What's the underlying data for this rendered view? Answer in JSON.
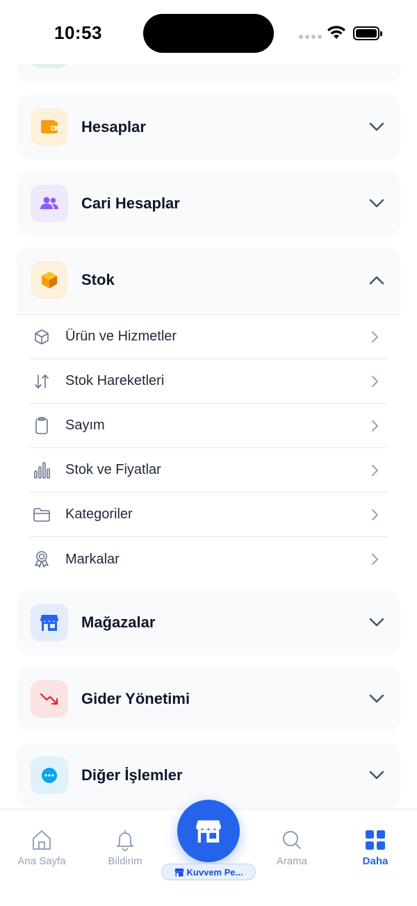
{
  "status_bar": {
    "time": "10:53"
  },
  "colors": {
    "accent": "#2563eb",
    "wallet": "#f59e0b",
    "people": "#8b5cf6",
    "box": "#f59e0b",
    "store": "#2563eb",
    "expense": "#dc2626",
    "more": "#0ea5e9"
  },
  "sections": [
    {
      "title": "Hesaplar",
      "icon": "wallet-icon",
      "expanded": false
    },
    {
      "title": "Cari Hesaplar",
      "icon": "people-icon",
      "expanded": false
    },
    {
      "title": "Stok",
      "icon": "box-icon",
      "expanded": true
    },
    {
      "title": "Mağazalar",
      "icon": "store-icon",
      "expanded": false
    },
    {
      "title": "Gider Yönetimi",
      "icon": "trend-down-icon",
      "expanded": false
    },
    {
      "title": "Diğer İşlemler",
      "icon": "more-icon",
      "expanded": false
    }
  ],
  "stok_items": [
    {
      "label": "Ürün ve Hizmetler",
      "icon": "cube-outline-icon"
    },
    {
      "label": "Stok Hareketleri",
      "icon": "arrows-up-down-icon"
    },
    {
      "label": "Sayım",
      "icon": "clipboard-icon"
    },
    {
      "label": "Stok ve Fiyatlar",
      "icon": "bar-chart-icon"
    },
    {
      "label": "Kategoriler",
      "icon": "folder-icon"
    },
    {
      "label": "Markalar",
      "icon": "badge-icon"
    }
  ],
  "tab_bar": {
    "home": "Ana Sayfa",
    "notifications": "Bildirim",
    "store_pill": "Kuvvem Pe...",
    "search": "Arama",
    "more": "Daha",
    "active": "more"
  }
}
